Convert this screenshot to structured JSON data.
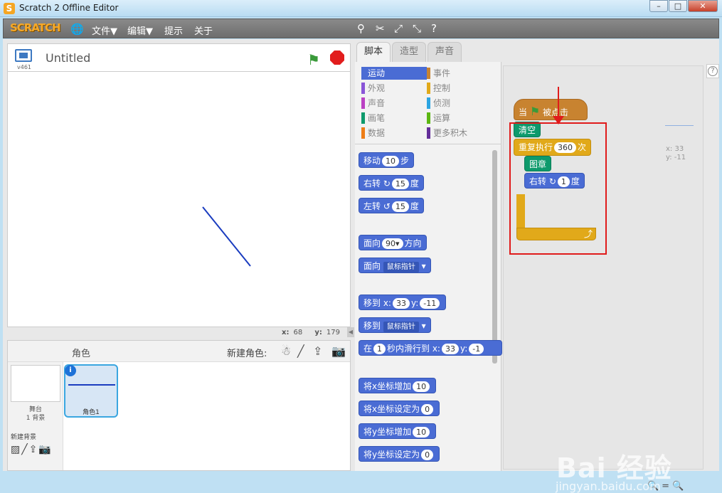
{
  "window": {
    "title": "Scratch 2 Offline Editor",
    "min": "–",
    "max": "□",
    "close": "✕"
  },
  "menubar": {
    "logo": "SCRATCH",
    "file": "文件▼",
    "edit": "编辑▼",
    "tips": "提示",
    "about": "关于"
  },
  "stage": {
    "version": "v461",
    "project_title": "Untitled",
    "mouse_x_label": "x:",
    "mouse_x": "68",
    "mouse_y_label": "y:",
    "mouse_y": "179"
  },
  "sprites": {
    "label": "角色",
    "new_sprite": "新建角色:",
    "stage_name": "舞台",
    "stage_backdrops": "1 背景",
    "new_backdrop": "新建背景",
    "sprite1_name": "角色1"
  },
  "tabs": {
    "scripts": "脚本",
    "costumes": "造型",
    "sounds": "声音"
  },
  "categories": [
    {
      "label": "运动",
      "color": "#4a6cd4",
      "active": true
    },
    {
      "label": "事件",
      "color": "#c88330"
    },
    {
      "label": "外观",
      "color": "#8a55d7"
    },
    {
      "label": "控制",
      "color": "#e1a91a"
    },
    {
      "label": "声音",
      "color": "#bb42c3"
    },
    {
      "label": "侦测",
      "color": "#2ca5e2"
    },
    {
      "label": "画笔",
      "color": "#0e9a6c"
    },
    {
      "label": "运算",
      "color": "#5cb712"
    },
    {
      "label": "数据",
      "color": "#ee7d16"
    },
    {
      "label": "更多积木",
      "color": "#632d99"
    }
  ],
  "palette": {
    "move": "移动",
    "move_val": "10",
    "move_unit": "步",
    "turn_r": "右转",
    "turn_r_val": "15",
    "deg": "度",
    "turn_l": "左转",
    "turn_l_val": "15",
    "point_dir": "面向",
    "point_dir_val": "90▾",
    "direction": "方向",
    "point_towards": "面向",
    "mouse_pointer": "鼠标指针",
    "goto_xy": "移到 x:",
    "goto_x": "33",
    "y_label": "y:",
    "goto_y": "-11",
    "goto": "移到",
    "glide_pre": "在",
    "glide_secs": "1",
    "glide_mid": "秒内滑行到 x:",
    "glide_x": "33",
    "glide_y": "-1",
    "change_x": "将x坐标增加",
    "change_x_val": "10",
    "set_x": "将x坐标设定为",
    "set_x_val": "0",
    "change_y": "将y坐标增加",
    "change_y_val": "10",
    "set_y": "将y坐标设定为",
    "set_y_val": "0"
  },
  "script": {
    "when_flag_pre": "当",
    "when_flag_post": "被点击",
    "clear": "清空",
    "repeat": "重复执行",
    "repeat_val": "360",
    "times": "次",
    "stamp": "图章",
    "turn": "右转",
    "turn_val": "1",
    "deg": "度",
    "sprite_x": "x: 33",
    "sprite_y": "y: -11"
  },
  "watermark": {
    "brand": "Bai  经验",
    "url": "jingyan.baidu.com"
  }
}
